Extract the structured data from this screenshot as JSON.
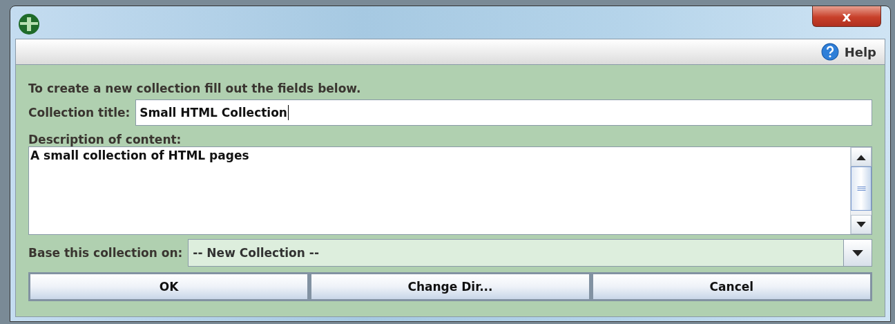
{
  "window": {
    "title_bar": {
      "close_button": "x"
    }
  },
  "toolbar": {
    "help": "Help"
  },
  "form": {
    "instruction": "To create a new collection fill out the fields below.",
    "title_label": "Collection title:",
    "title_value": "Small HTML Collection",
    "description_label": "Description of content:",
    "description_value": "A small collection of HTML pages",
    "base_label": "Base this collection on:",
    "base_value": "-- New Collection --"
  },
  "buttons": [
    {
      "label": "OK"
    },
    {
      "label": "Change Dir..."
    },
    {
      "label": "Cancel"
    }
  ]
}
